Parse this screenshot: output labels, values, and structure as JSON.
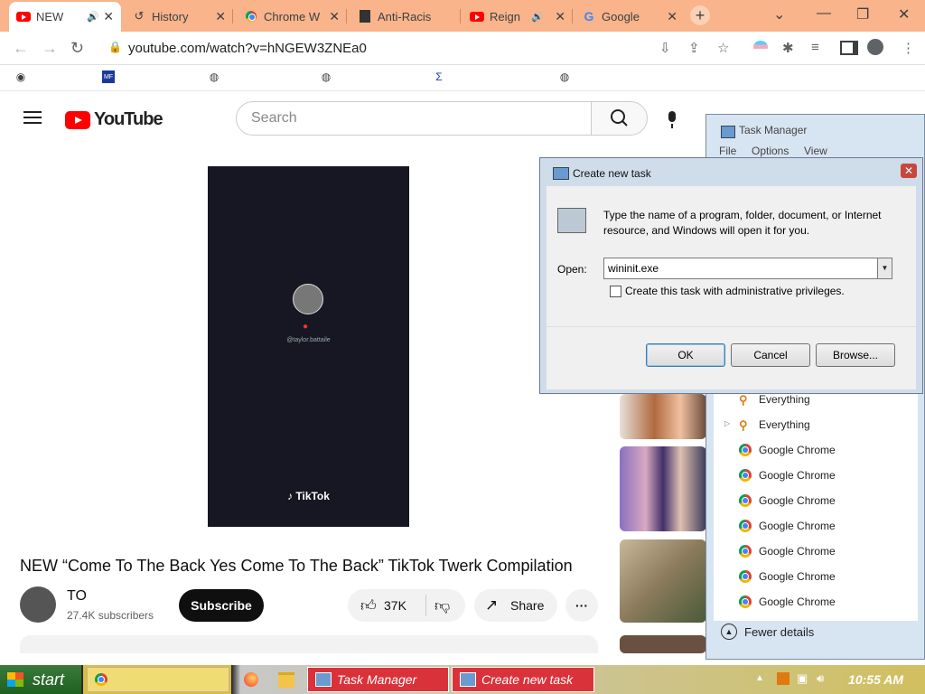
{
  "browser": {
    "tabs": [
      {
        "label": "NEW",
        "icon": "youtube-icon",
        "audio": true,
        "active": true
      },
      {
        "label": "History",
        "icon": "history-icon"
      },
      {
        "label": "Chrome W",
        "icon": "chrome-web-store-icon"
      },
      {
        "label": "Anti-Racis",
        "icon": "page-icon"
      },
      {
        "label": "Reign",
        "icon": "youtube-icon",
        "audio": true
      },
      {
        "label": "Google",
        "icon": "google-icon"
      }
    ],
    "url": "youtube.com/watch?v=hNGEW3ZNEa0",
    "bookmarks": [
      {
        "label": "",
        "icon": "reddit-icon"
      },
      {
        "label": "",
        "icon": "mediafire-icon"
      },
      {
        "label": "",
        "icon": "globe-icon"
      },
      {
        "label": "",
        "icon": "globe-icon"
      },
      {
        "label": "",
        "icon": "sigma-icon"
      },
      {
        "label": "",
        "icon": "globe-icon"
      }
    ]
  },
  "youtube": {
    "logo_text": "YouTube",
    "search_placeholder": "Search",
    "video": {
      "handle": "@taylor.battaile",
      "watermark": "TikTok"
    },
    "title": "NEW “Come To The Back Yes Come To The Back” TikTok Twerk Compilation",
    "channel": {
      "name": "TO",
      "subscribers": "27.4K subscribers"
    },
    "subscribe_label": "Subscribe",
    "likes": "37K",
    "share_label": "Share"
  },
  "task_manager": {
    "title": "Task Manager",
    "menu": [
      "File",
      "Options",
      "View"
    ],
    "rows": [
      {
        "label": "Everything",
        "icon": "search-icon"
      },
      {
        "label": "Everything",
        "icon": "search-icon",
        "expandable": true
      },
      {
        "label": "Google Chrome",
        "icon": "chrome-icon"
      },
      {
        "label": "Google Chrome",
        "icon": "chrome-icon"
      },
      {
        "label": "Google Chrome",
        "icon": "chrome-icon"
      },
      {
        "label": "Google Chrome",
        "icon": "chrome-icon"
      },
      {
        "label": "Google Chrome",
        "icon": "chrome-icon"
      },
      {
        "label": "Google Chrome",
        "icon": "chrome-icon"
      },
      {
        "label": "Google Chrome",
        "icon": "chrome-icon"
      }
    ],
    "fewer_details": "Fewer details"
  },
  "dialog": {
    "title": "Create new task",
    "description": "Type the name of a program, folder, document, or Internet resource, and Windows will open it for you.",
    "open_label": "Open:",
    "open_value": "wininit.exe",
    "admin_checkbox_label": "Create this task with administrative privileges.",
    "admin_checked": false,
    "ok_label": "OK",
    "cancel_label": "Cancel",
    "browse_label": "Browse..."
  },
  "taskbar": {
    "start_label": "start",
    "tasks": [
      {
        "label": "",
        "icon": "chrome-icon"
      },
      {
        "label": "",
        "icon": "firefox-icon"
      },
      {
        "label": "",
        "icon": "folder-icon"
      },
      {
        "label": "Task Manager",
        "icon": "task-manager-icon"
      },
      {
        "label": "Create new task",
        "icon": "run-icon"
      }
    ],
    "clock": "10:55 AM"
  },
  "colors": {
    "tabstrip": "#f9b48b",
    "youtube_red": "#ff0000",
    "start_green": "#2f6f2f",
    "taskbar_task": "#d9323a"
  }
}
